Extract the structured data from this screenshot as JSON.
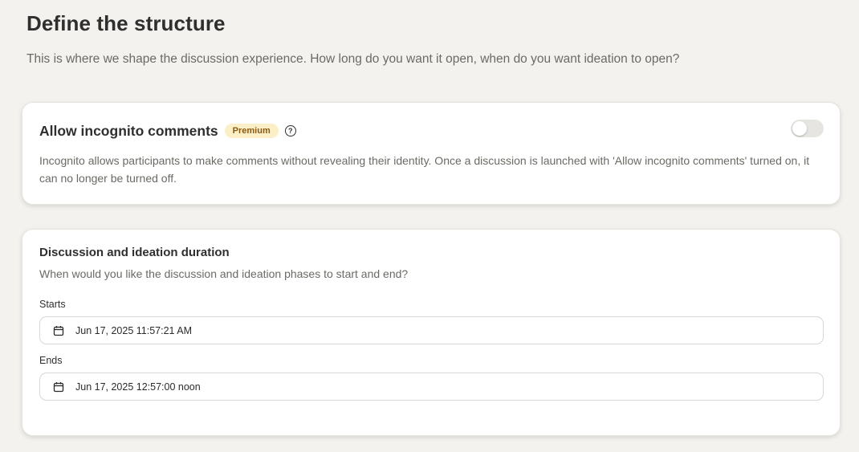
{
  "header": {
    "title": "Define the structure",
    "subtitle": "This is where we shape the discussion experience. How long do you want it open, when do you want ideation to open?"
  },
  "incognito": {
    "title": "Allow incognito comments",
    "badge": "Premium",
    "help_icon": "question-circle-icon",
    "help_glyph": "?",
    "toggle_on": false,
    "description": "Incognito allows participants to make comments without revealing their identity. Once a discussion is launched with 'Allow incognito comments' turned on, it can no longer be turned off."
  },
  "duration": {
    "title": "Discussion and ideation duration",
    "description": "When would you like the discussion and ideation phases to start and end?",
    "starts": {
      "label": "Starts",
      "icon": "calendar-icon",
      "value": "Jun 17, 2025 11:57:21 AM"
    },
    "ends": {
      "label": "Ends",
      "icon": "calendar-icon",
      "value": "Jun 17, 2025 12:57:00 noon"
    }
  },
  "colors": {
    "background": "#f3f2ee",
    "card": "#ffffff",
    "badge_bg": "#fbefc8",
    "badge_text": "#8a5a12",
    "muted_text": "#6b6a64",
    "toggle_off": "#e6e5e2"
  }
}
